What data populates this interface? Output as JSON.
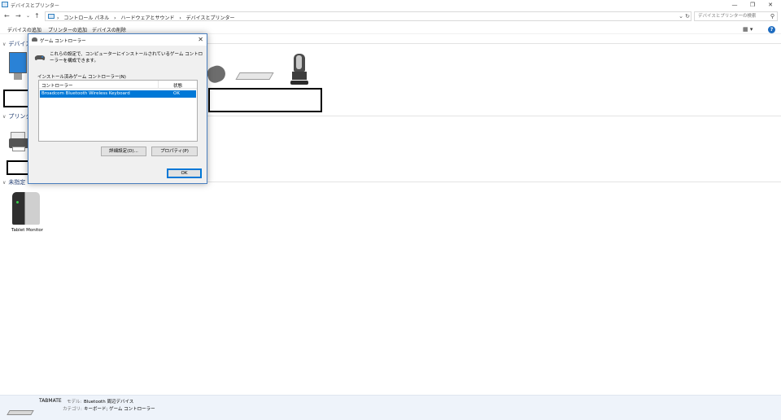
{
  "window": {
    "title": "デバイスとプリンター",
    "minimize": "—",
    "restore": "❐",
    "close": "✕"
  },
  "nav": {
    "back": "←",
    "forward": "→",
    "recent": "⌄",
    "up": "↑"
  },
  "address": {
    "crumbs": [
      "›",
      "コントロール パネル",
      "›",
      "ハードウェアとサウンド",
      "›",
      "デバイスとプリンター"
    ],
    "dropdown": "⌄",
    "refresh": "↻"
  },
  "search": {
    "placeholder": "デバイスとプリンターの検索",
    "icon": "⚲"
  },
  "commands": {
    "add_device": "デバイスの追加",
    "add_printer": "プリンターの追加",
    "remove_device": "デバイスの削除",
    "view_icon": "▦ ▾",
    "help": "?"
  },
  "groups": {
    "devices": "デバイス",
    "printers": "プリンタ",
    "unspecified": "未指定"
  },
  "devices": {
    "tablet_monitor_label": "Tablet Monitor"
  },
  "dialog": {
    "title": "ゲーム コントローラー",
    "close": "✕",
    "description": "これらの設定で、コンピューターにインストールされているゲーム コントローラーを構成できます。",
    "installed_label": "インストール済みゲーム コントローラー(N)",
    "columns": {
      "controller": "コントローラー",
      "status": "状態"
    },
    "rows": [
      {
        "controller": "Broadcom Bluetooth Wireless  Keyboard",
        "status": "OK"
      }
    ],
    "advanced_button": "詳細設定(D)...",
    "properties_button": "プロパティ(P)",
    "ok_button": "OK"
  },
  "details": {
    "name": "TABMATE",
    "model_key": "モデル:",
    "model_value": "Bluetooth 周辺デバイス",
    "category_key": "カテゴリ:",
    "category_value": "キーボード; ゲーム コントローラー"
  }
}
